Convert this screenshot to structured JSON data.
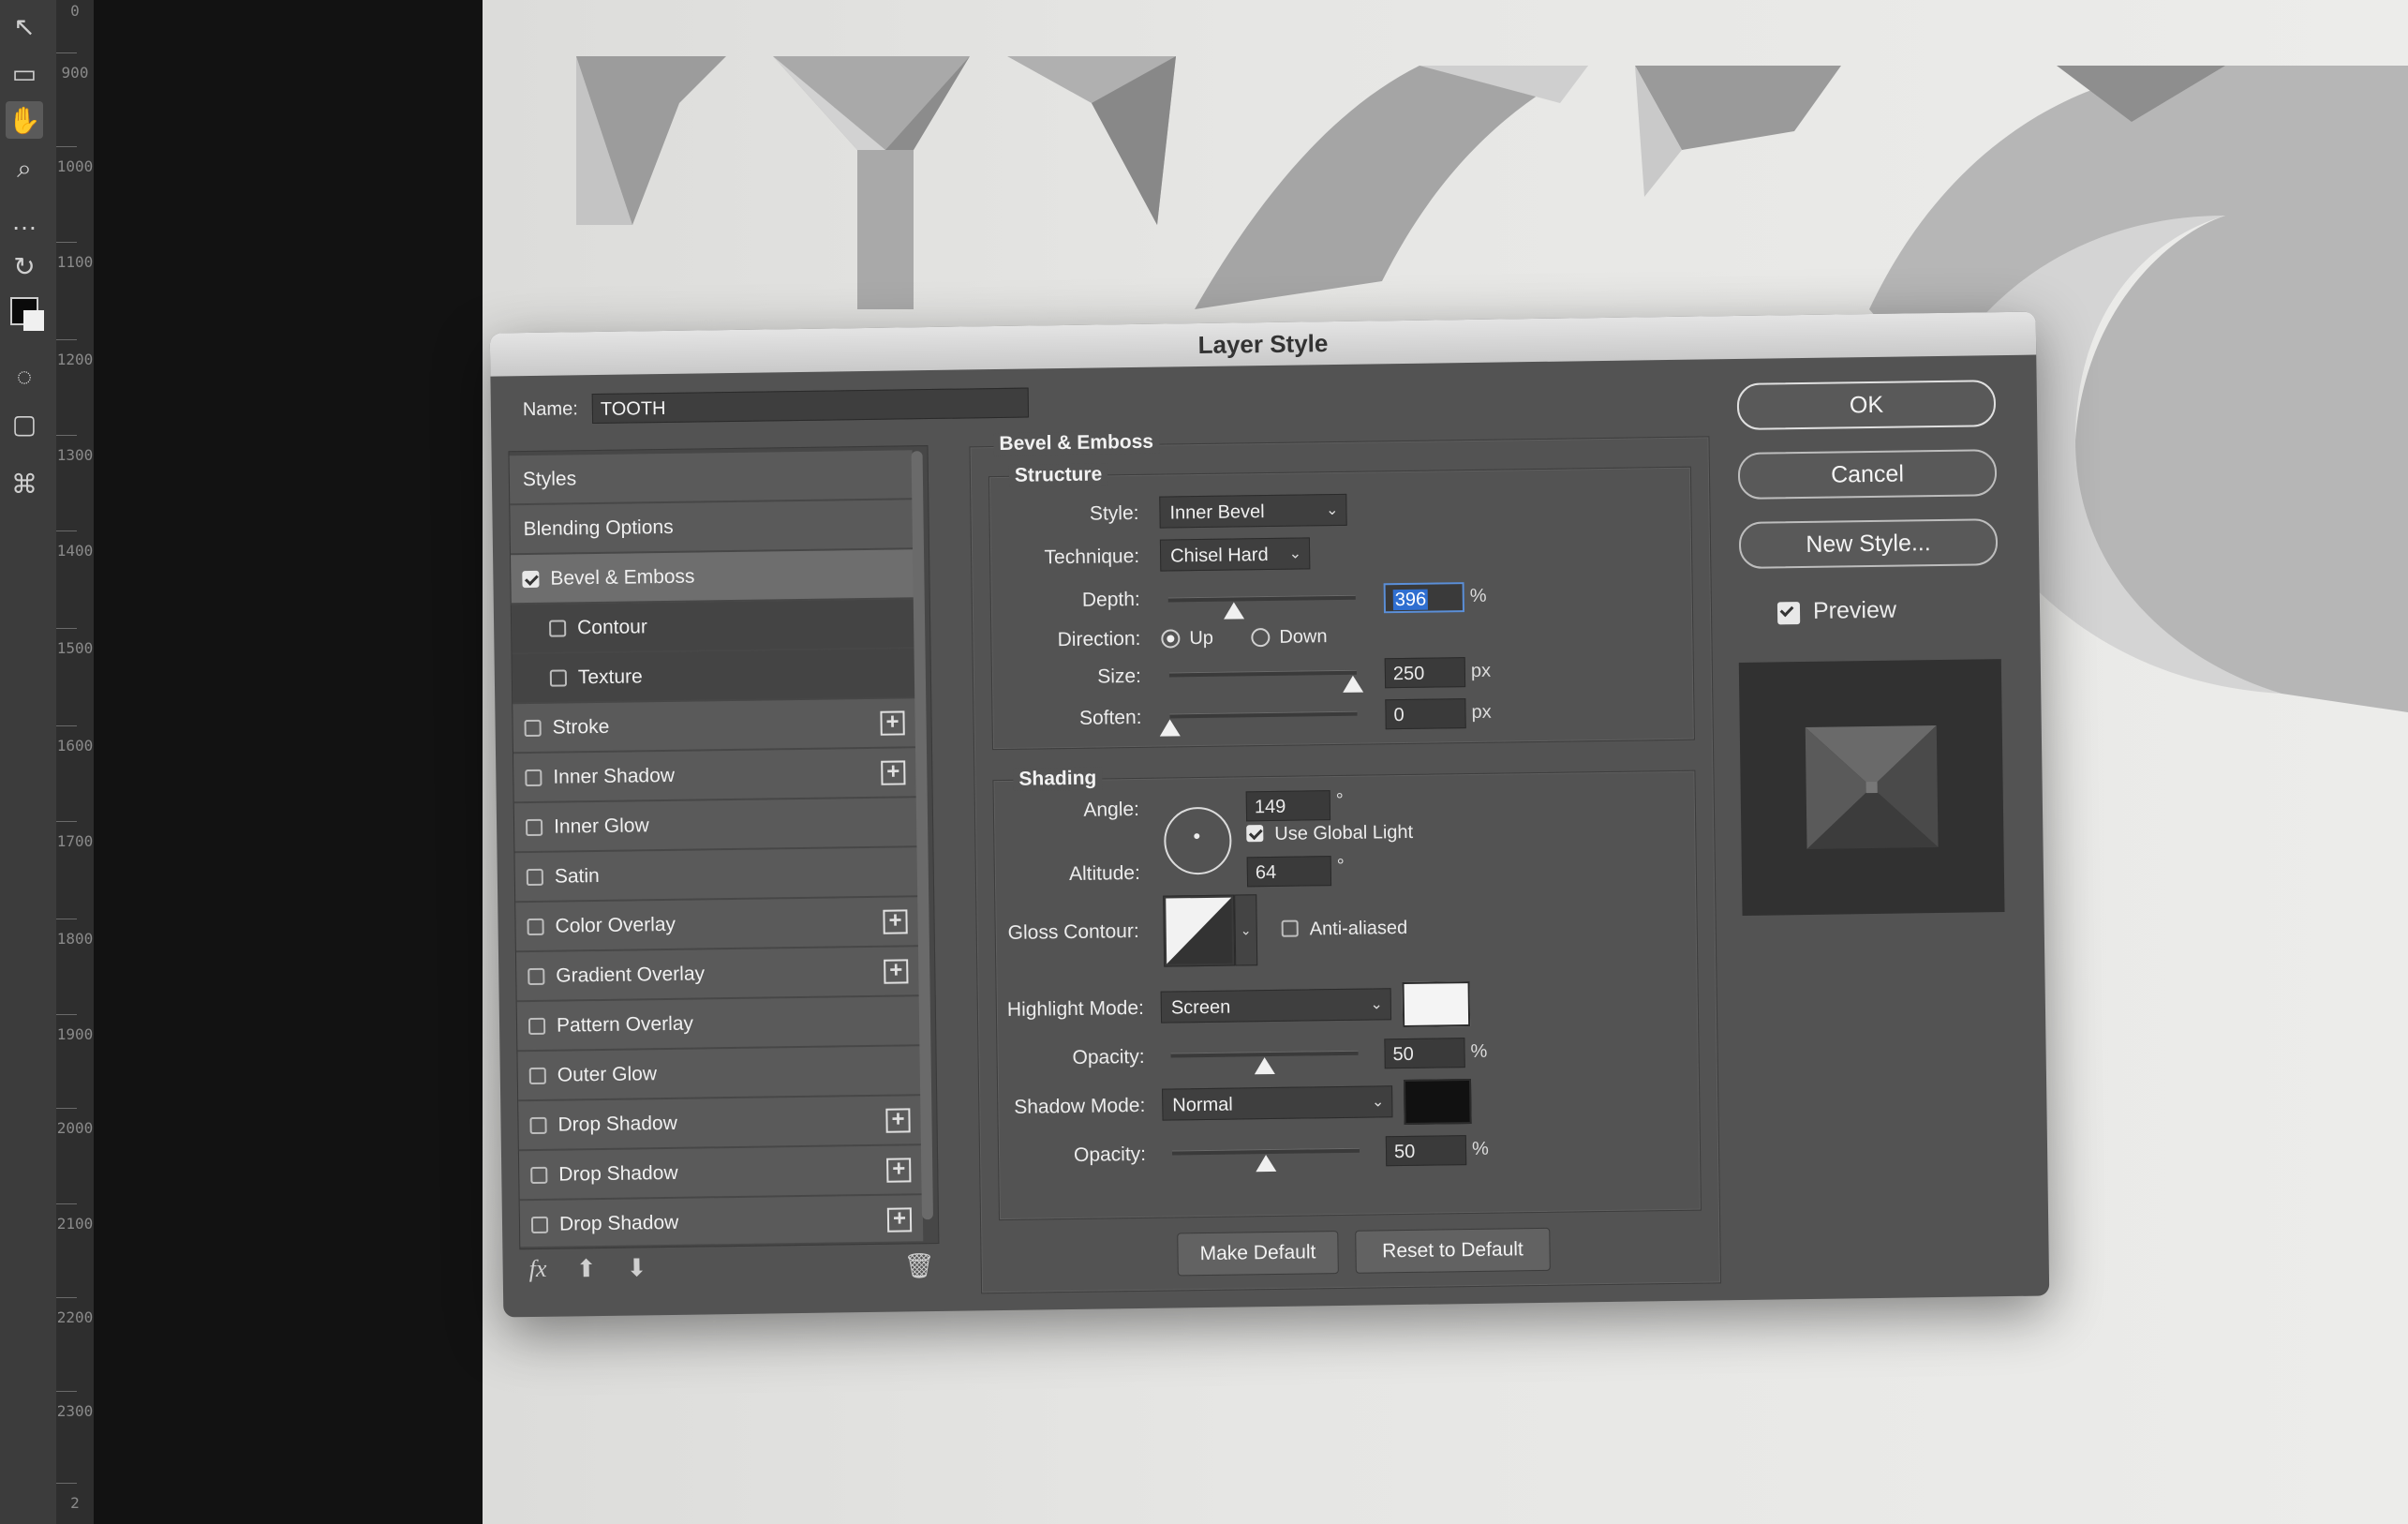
{
  "toolbar": {
    "tools": [
      "arrow-select-icon",
      "rectangle-marquee-icon",
      "hand-icon",
      "zoom-icon",
      "more-icon",
      "swap-icon",
      "color-swatch-icon",
      "quick-mask-icon",
      "screen-mode-icon",
      "share-icon"
    ]
  },
  "ruler": {
    "ticks": [
      "0",
      "900",
      "1000",
      "1100",
      "1200",
      "1300",
      "1400",
      "1500",
      "1600",
      "1700",
      "1800",
      "1900",
      "2000",
      "2100",
      "2200",
      "2300",
      "2"
    ]
  },
  "dialog": {
    "title": "Layer Style",
    "name_label": "Name:",
    "name_value": "TOOTH",
    "styles_list": [
      {
        "label": "Styles",
        "kind": "header"
      },
      {
        "label": "Blending Options",
        "kind": "header"
      },
      {
        "label": "Bevel & Emboss",
        "kind": "item",
        "checked": true,
        "selected": true
      },
      {
        "label": "Contour",
        "kind": "sub",
        "checked": false
      },
      {
        "label": "Texture",
        "kind": "sub",
        "checked": false
      },
      {
        "label": "Stroke",
        "kind": "item",
        "checked": false,
        "plus": true
      },
      {
        "label": "Inner Shadow",
        "kind": "item",
        "checked": false,
        "plus": true
      },
      {
        "label": "Inner Glow",
        "kind": "item",
        "checked": false
      },
      {
        "label": "Satin",
        "kind": "item",
        "checked": false
      },
      {
        "label": "Color Overlay",
        "kind": "item",
        "checked": false,
        "plus": true
      },
      {
        "label": "Gradient Overlay",
        "kind": "item",
        "checked": false,
        "plus": true
      },
      {
        "label": "Pattern Overlay",
        "kind": "item",
        "checked": false
      },
      {
        "label": "Outer Glow",
        "kind": "item",
        "checked": false
      },
      {
        "label": "Drop Shadow",
        "kind": "item",
        "checked": false,
        "plus": true
      },
      {
        "label": "Drop Shadow",
        "kind": "item",
        "checked": false,
        "plus": true
      },
      {
        "label": "Drop Shadow",
        "kind": "item",
        "checked": false,
        "plus": true
      }
    ],
    "list_footer": {
      "fx": "fx",
      "up_icon": "arrow-up-icon",
      "down_icon": "arrow-down-icon",
      "trash_icon": "trash-icon"
    },
    "bevel": {
      "section_title": "Bevel & Emboss",
      "structure_title": "Structure",
      "style_label": "Style:",
      "style_value": "Inner Bevel",
      "technique_label": "Technique:",
      "technique_value": "Chisel Hard",
      "depth_label": "Depth:",
      "depth_value": "396",
      "depth_unit": "%",
      "depth_slider": 0.35,
      "direction_label": "Direction:",
      "direction_up": "Up",
      "direction_down": "Down",
      "direction_selected": "Up",
      "size_label": "Size:",
      "size_value": "250",
      "size_unit": "px",
      "size_slider": 0.98,
      "soften_label": "Soften:",
      "soften_value": "0",
      "soften_unit": "px",
      "soften_slider": 0.0
    },
    "shading": {
      "title": "Shading",
      "angle_label": "Angle:",
      "angle_value": "149",
      "angle_unit": "°",
      "use_global_light": "Use Global Light",
      "use_global_light_checked": true,
      "altitude_label": "Altitude:",
      "altitude_value": "64",
      "altitude_unit": "°",
      "gloss_label": "Gloss Contour:",
      "anti_aliased": "Anti-aliased",
      "anti_aliased_checked": false,
      "highlight_mode_label": "Highlight Mode:",
      "highlight_mode_value": "Screen",
      "highlight_color": "#f4f4f4",
      "highlight_opacity_label": "Opacity:",
      "highlight_opacity_value": "50",
      "highlight_opacity_unit": "%",
      "highlight_opacity_slider": 0.5,
      "shadow_mode_label": "Shadow Mode:",
      "shadow_mode_value": "Normal",
      "shadow_color": "#111111",
      "shadow_opacity_label": "Opacity:",
      "shadow_opacity_value": "50",
      "shadow_opacity_unit": "%",
      "shadow_opacity_slider": 0.5
    },
    "make_default": "Make Default",
    "reset_default": "Reset to Default",
    "ok": "OK",
    "cancel": "Cancel",
    "new_style": "New Style...",
    "preview_label": "Preview",
    "preview_checked": true
  }
}
